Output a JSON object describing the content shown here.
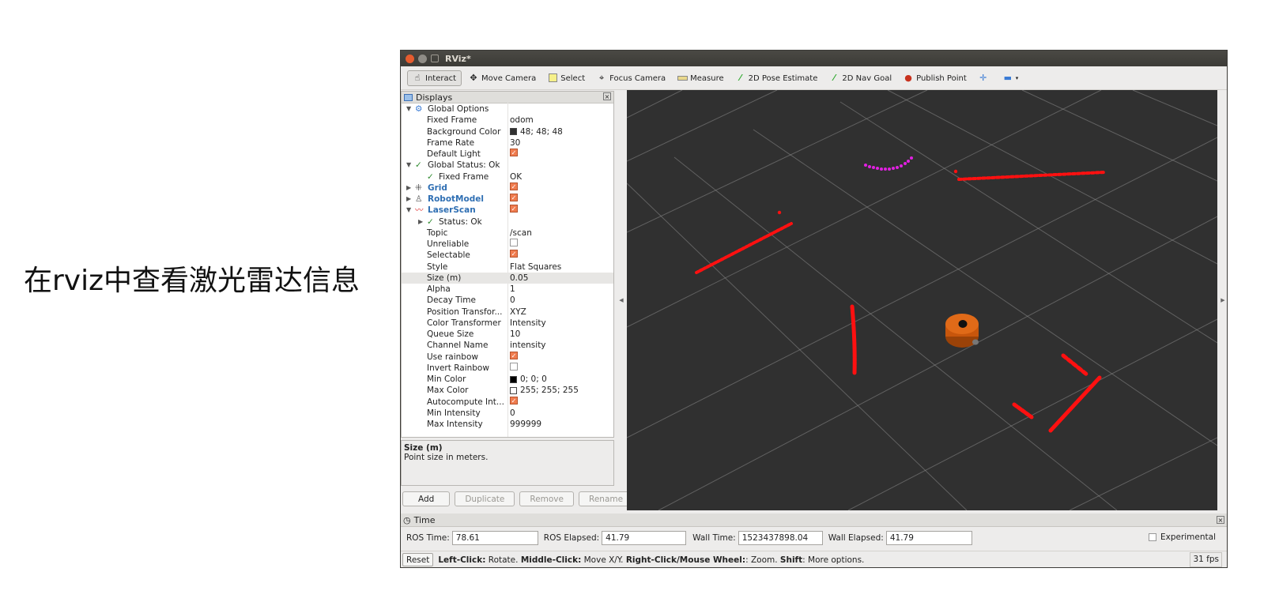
{
  "caption": "在rviz中查看激光雷达信息",
  "window": {
    "title": "RViz*"
  },
  "toolbar": {
    "tools": [
      {
        "label": "Interact",
        "icon": "hand-icon"
      },
      {
        "label": "Move Camera",
        "icon": "move-camera-icon"
      },
      {
        "label": "Select",
        "icon": "select-icon"
      },
      {
        "label": "Focus Camera",
        "icon": "focus-camera-icon"
      },
      {
        "label": "Measure",
        "icon": "ruler-icon"
      },
      {
        "label": "2D Pose Estimate",
        "icon": "green-arrow-icon"
      },
      {
        "label": "2D Nav Goal",
        "icon": "green-arrow-icon"
      },
      {
        "label": "Publish Point",
        "icon": "map-pin-icon"
      }
    ]
  },
  "displays": {
    "title": "Displays",
    "rows": {
      "global_options": "Global Options",
      "fixed_frame": {
        "name": "Fixed Frame",
        "value": "odom"
      },
      "background_color": {
        "name": "Background Color",
        "value": "48; 48; 48",
        "color": "#303030"
      },
      "frame_rate": {
        "name": "Frame Rate",
        "value": "30"
      },
      "default_light": {
        "name": "Default Light",
        "checked": true
      },
      "global_status": "Global Status: Ok",
      "gs_fixed_frame": {
        "name": "Fixed Frame",
        "value": "OK"
      },
      "grid": {
        "name": "Grid",
        "checked": true
      },
      "robot_model": {
        "name": "RobotModel",
        "checked": true
      },
      "laser_scan": {
        "name": "LaserScan",
        "checked": true
      },
      "status_ok": "Status: Ok",
      "topic": {
        "name": "Topic",
        "value": "/scan"
      },
      "unreliable": {
        "name": "Unreliable",
        "checked": false
      },
      "selectable": {
        "name": "Selectable",
        "checked": true
      },
      "style": {
        "name": "Style",
        "value": "Flat Squares"
      },
      "size": {
        "name": "Size (m)",
        "value": "0.05"
      },
      "alpha": {
        "name": "Alpha",
        "value": "1"
      },
      "decay_time": {
        "name": "Decay Time",
        "value": "0"
      },
      "position_transformer": {
        "name": "Position Transfor...",
        "value": "XYZ"
      },
      "color_transformer": {
        "name": "Color Transformer",
        "value": "Intensity"
      },
      "queue_size": {
        "name": "Queue Size",
        "value": "10"
      },
      "channel_name": {
        "name": "Channel Name",
        "value": "intensity"
      },
      "use_rainbow": {
        "name": "Use rainbow",
        "checked": true
      },
      "invert_rainbow": {
        "name": "Invert Rainbow",
        "checked": false
      },
      "min_color": {
        "name": "Min Color",
        "value": "0; 0; 0",
        "color": "#000000"
      },
      "max_color": {
        "name": "Max Color",
        "value": "255; 255; 255",
        "color": "#ffffff"
      },
      "autocompute": {
        "name": "Autocompute Int...",
        "checked": true
      },
      "min_intensity": {
        "name": "Min Intensity",
        "value": "0"
      },
      "max_intensity": {
        "name": "Max Intensity",
        "value": "999999"
      }
    }
  },
  "description": {
    "title": "Size (m)",
    "text": "Point size in meters."
  },
  "panel_buttons": {
    "add": "Add",
    "duplicate": "Duplicate",
    "remove": "Remove",
    "rename": "Rename"
  },
  "time_panel": {
    "title": "Time",
    "ros_time_label": "ROS Time:",
    "ros_time": "78.61",
    "ros_elapsed_label": "ROS Elapsed:",
    "ros_elapsed": "41.79",
    "wall_time_label": "Wall Time:",
    "wall_time": "1523437898.04",
    "wall_elapsed_label": "Wall Elapsed:",
    "wall_elapsed": "41.79",
    "experimental": "Experimental"
  },
  "status_bar": {
    "reset": "Reset",
    "hint_left_click": "Left-Click:",
    "hint_rotate": " Rotate. ",
    "hint_middle_click": "Middle-Click:",
    "hint_move": " Move X/Y. ",
    "hint_right_click": "Right-Click/Mouse Wheel:",
    "hint_zoom": ": Zoom. ",
    "hint_shift": "Shift",
    "hint_more": ": More options.",
    "fps": "31 fps"
  },
  "colors": {
    "viewport_bg": "#303030",
    "laser_red": "#ff1010",
    "laser_magenta": "#e020e0",
    "robot_orange": "#d2600f",
    "checkbox": "#f07c4f"
  }
}
